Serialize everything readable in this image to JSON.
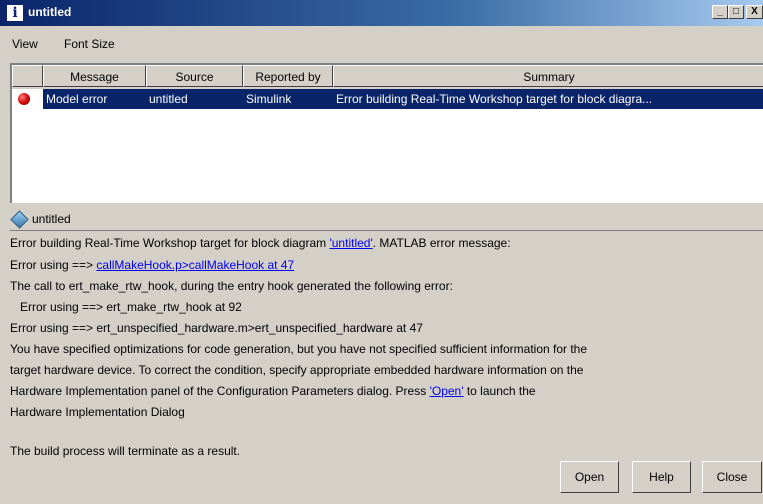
{
  "window": {
    "title": "untitled"
  },
  "menu": {
    "items": [
      "View",
      "Font Size"
    ]
  },
  "table": {
    "columns": [
      "Message",
      "Source",
      "Reported by",
      "Summary"
    ],
    "rows": [
      {
        "message": "Model error",
        "source": "untitled",
        "reported_by": "Simulink",
        "summary": "Error building Real-Time Workshop target for block diagra..."
      }
    ]
  },
  "detail": {
    "header": "untitled",
    "line1_pre": "Error building Real-Time Workshop target for block diagram ",
    "line1_link": "'untitled'",
    "line1_post": ". MATLAB error message:",
    "line2_pre": "Error using ==> ",
    "line2_link": "callMakeHook.p>callMakeHook at 47",
    "line3": "The call to ert_make_rtw_hook, during the entry hook generated the following error:",
    "line4": "   Error using ==> ert_make_rtw_hook at 92",
    "line5": "Error using ==> ert_unspecified_hardware.m>ert_unspecified_hardware at 47",
    "line6": "You have specified optimizations for code generation, but you have not specified sufficient information for the",
    "line7": "target hardware device. To correct the condition, specify appropriate embedded hardware information on the",
    "line8_pre": "Hardware Implementation panel of the Configuration Parameters dialog.  Press ",
    "line8_link": "'Open'",
    "line8_post": " to launch the",
    "line9": "Hardware Implementation Dialog",
    "line10": "The build process will terminate as a result."
  },
  "buttons": {
    "open": "Open",
    "help": "Help",
    "close": "Close"
  }
}
